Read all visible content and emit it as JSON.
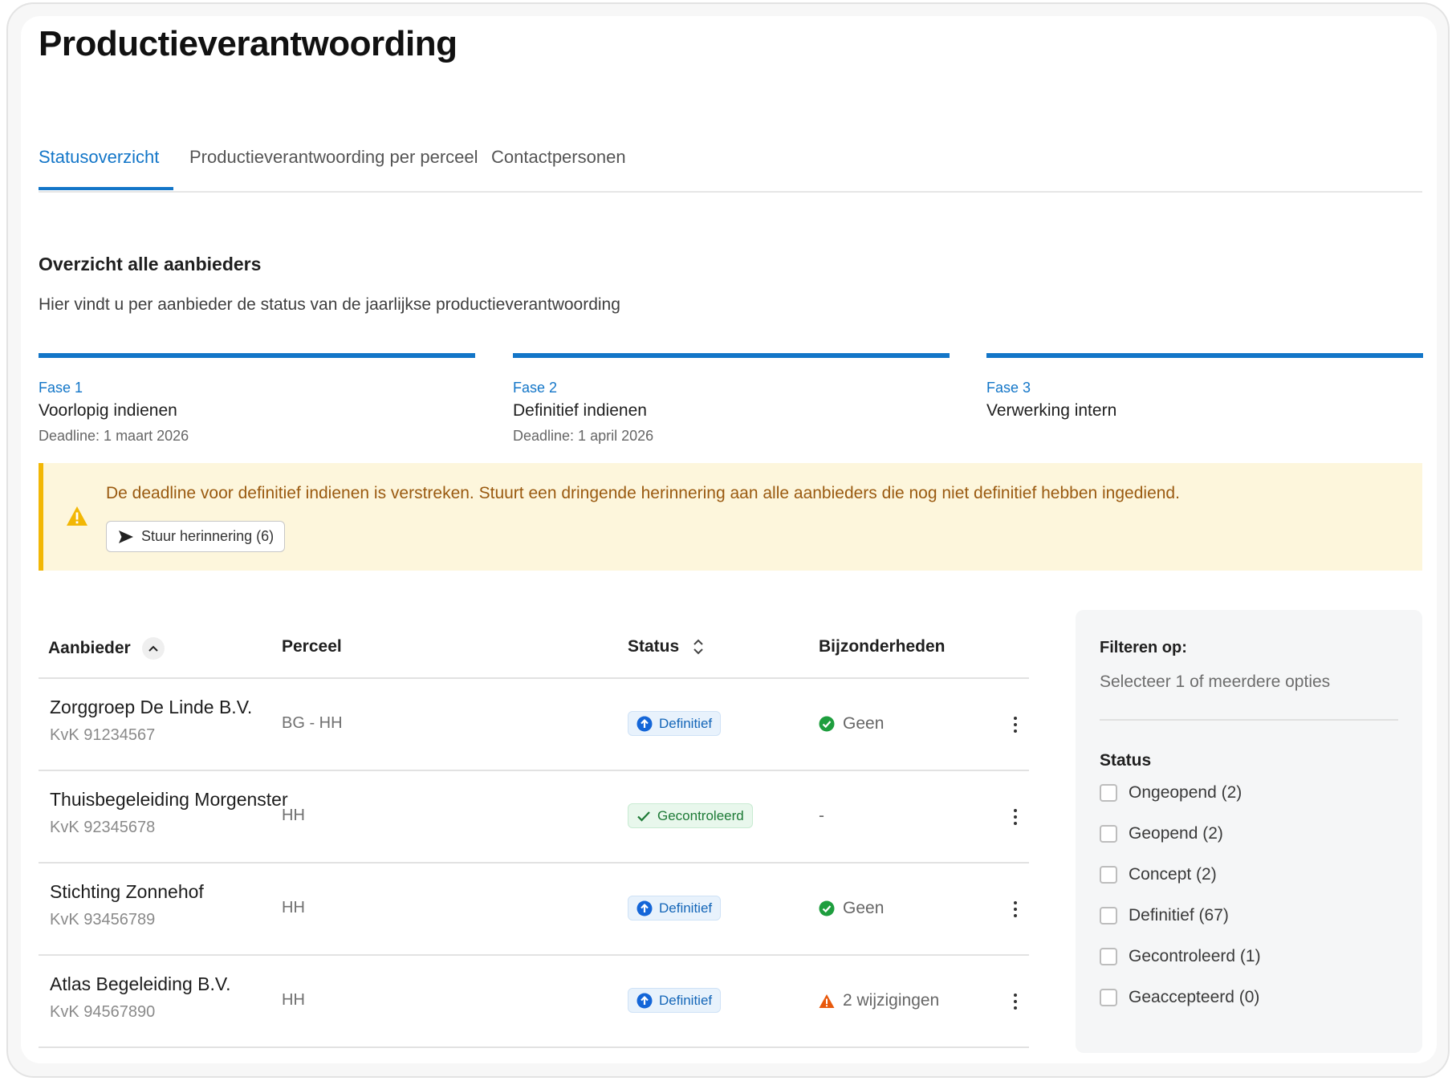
{
  "page": {
    "title": "Productieverantwoording"
  },
  "tabs": [
    {
      "label": "Statusoverzicht",
      "active": true
    },
    {
      "label": "Productieverantwoording per perceel",
      "active": false
    },
    {
      "label": "Contactpersonen",
      "active": false
    }
  ],
  "overview": {
    "title": "Overzicht alle aanbieders",
    "description": "Hier vindt u per aanbieder de status van de jaarlijkse productieverantwoording"
  },
  "phases": [
    {
      "label": "Fase 1",
      "name": "Voorlopig indienen",
      "deadline": "Deadline: 1 maart 2026"
    },
    {
      "label": "Fase 2",
      "name": "Definitief indienen",
      "deadline": "Deadline: 1 april 2026"
    },
    {
      "label": "Fase 3",
      "name": "Verwerking intern",
      "deadline": ""
    }
  ],
  "alert": {
    "text": "De deadline voor definitief indienen is verstreken. Stuurt een dringende herinnering aan alle aanbieders die nog niet definitief hebben ingediend.",
    "button_label": "Stuur herinnering (6)",
    "icon": "warning-icon"
  },
  "table": {
    "columns": [
      "Aanbieder",
      "Perceel",
      "Status",
      "Bijzonderheden"
    ],
    "rows": [
      {
        "name": "Zorggroep De Linde B.V.",
        "kvk": "KvK 91234567",
        "perceel": "BG - HH",
        "status": "Definitief",
        "bijzonderheden": "Geen",
        "bijz_icon": "check-circle-icon"
      },
      {
        "name": "Thuisbegeleiding Morgenster",
        "kvk": "KvK 92345678",
        "perceel": "HH",
        "status": "Gecontroleerd",
        "bijzonderheden": "-",
        "bijz_icon": ""
      },
      {
        "name": "Stichting Zonnehof",
        "kvk": "KvK 93456789",
        "perceel": "HH",
        "status": "Definitief",
        "bijzonderheden": "Geen",
        "bijz_icon": "check-circle-icon"
      },
      {
        "name": "Atlas Begeleiding B.V.",
        "kvk": "KvK 94567890",
        "perceel": "HH",
        "status": "Definitief",
        "bijzonderheden": "2 wijzigingen",
        "bijz_icon": "warning-icon"
      }
    ]
  },
  "filter": {
    "title": "Filteren op:",
    "subtitle": "Selecteer 1 of meerdere opties",
    "status_title": "Status",
    "options": [
      "Ongeopend (2)",
      "Geopend (2)",
      "Concept (2)",
      "Definitief (67)",
      "Gecontroleerd (1)",
      "Geaccepteerd (0)"
    ]
  },
  "colors": {
    "accent": "#1376c8",
    "alert_bg": "#fdf6dc",
    "alert_border": "#f2b705",
    "success": "#1e9e3e",
    "warning": "#e8590c"
  }
}
